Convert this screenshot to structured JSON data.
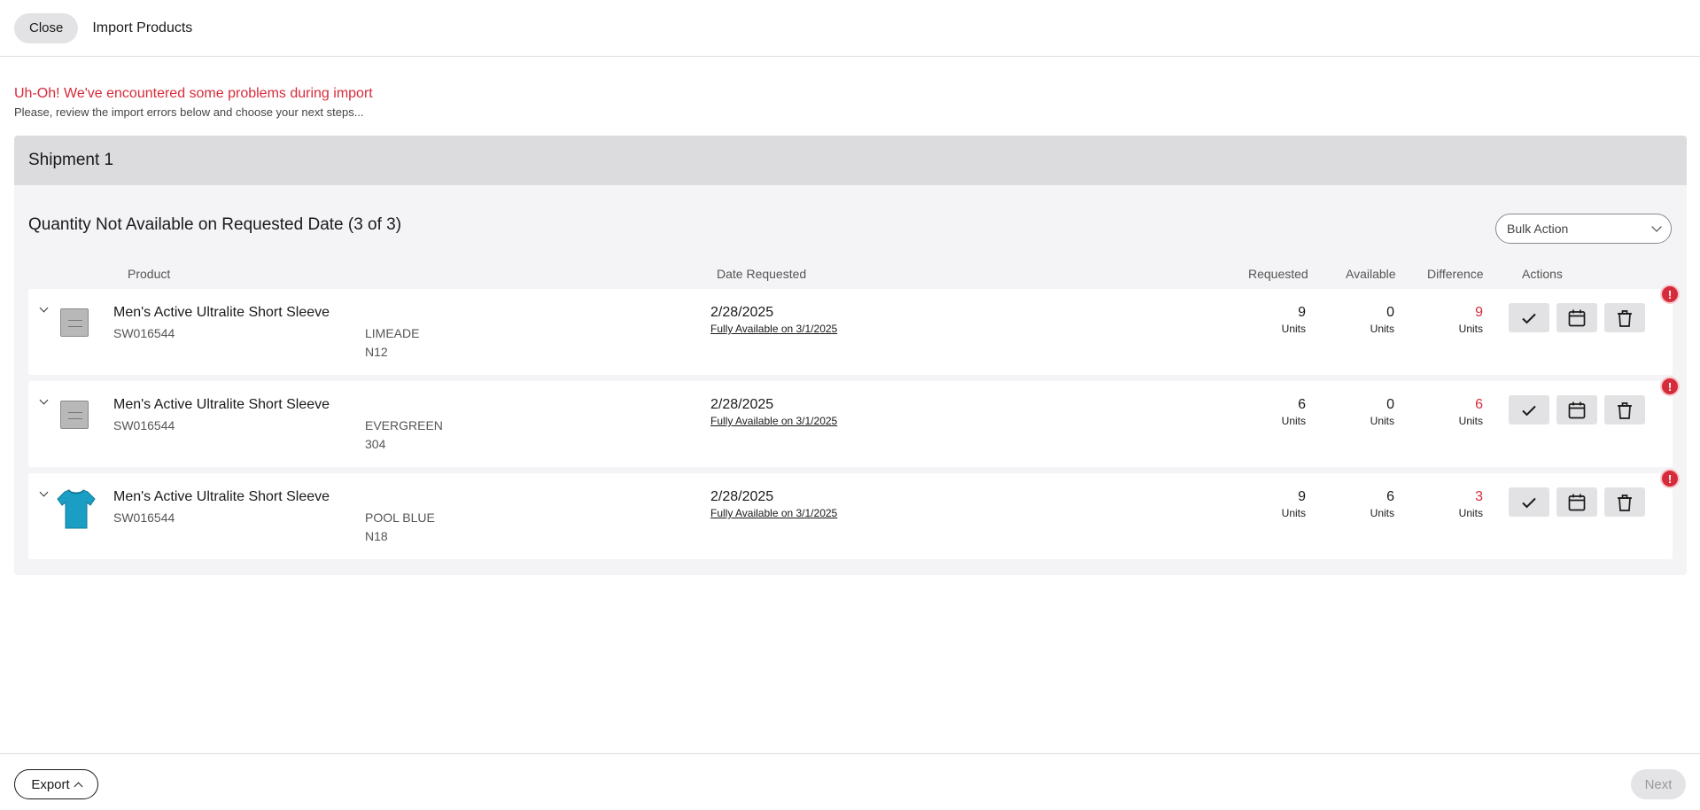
{
  "header": {
    "close_label": "Close",
    "title": "Import Products"
  },
  "error": {
    "title": "Uh-Oh! We've encountered some problems during import",
    "subtitle": "Please, review the import errors below and choose your next steps..."
  },
  "shipment": {
    "title": "Shipment 1",
    "section_title": "Quantity Not Available on Requested Date (3 of 3)",
    "bulk_action_label": "Bulk Action",
    "columns": {
      "product": "Product",
      "date_requested": "Date Requested",
      "requested": "Requested",
      "available": "Available",
      "difference": "Difference",
      "actions": "Actions"
    },
    "rows": [
      {
        "name": "Men's Active Ultralite Short Sleeve",
        "sku": "SW016544",
        "color": "LIMEADE",
        "size": "N12",
        "date": "2/28/2025",
        "availability": "Fully Available on 3/1/2025",
        "requested": "9",
        "requested_unit": "Units",
        "available": "0",
        "available_unit": "Units",
        "difference": "9",
        "difference_unit": "Units",
        "image": "placeholder",
        "error_badge": "!"
      },
      {
        "name": "Men's Active Ultralite Short Sleeve",
        "sku": "SW016544",
        "color": "EVERGREEN",
        "size": "304",
        "date": "2/28/2025",
        "availability": "Fully Available on 3/1/2025",
        "requested": "6",
        "requested_unit": "Units",
        "available": "0",
        "available_unit": "Units",
        "difference": "6",
        "difference_unit": "Units",
        "image": "placeholder",
        "error_badge": "!"
      },
      {
        "name": "Men's Active Ultralite Short Sleeve",
        "sku": "SW016544",
        "color": "POOL BLUE",
        "size": "N18",
        "date": "2/28/2025",
        "availability": "Fully Available on 3/1/2025",
        "requested": "9",
        "requested_unit": "Units",
        "available": "6",
        "available_unit": "Units",
        "difference": "3",
        "difference_unit": "Units",
        "image": "shirt",
        "error_badge": "!"
      }
    ]
  },
  "footer": {
    "export_label": "Export",
    "next_label": "Next"
  },
  "colors": {
    "error_red": "#d62b3a",
    "shirt_blue": "#1a9ec4",
    "panel_bg": "#f4f4f6",
    "header_bg": "#dcdcde"
  },
  "icons": {
    "approve": "check-icon",
    "reschedule": "calendar-icon",
    "delete": "trash-icon",
    "expand": "chevron-down-icon",
    "error": "alert-icon"
  }
}
